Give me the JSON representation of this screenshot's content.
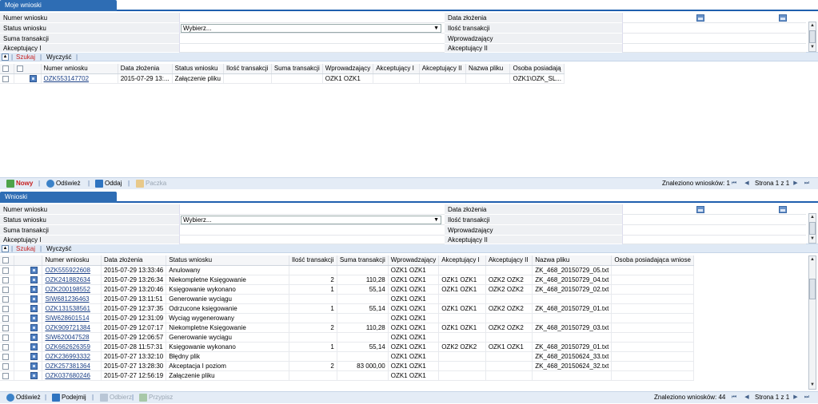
{
  "top": {
    "tab": "Moje wnioski",
    "filters": {
      "numer": "Numer wniosku",
      "status": "Status wniosku",
      "suma": "Suma transakcji",
      "akc1": "Akceptujący I",
      "data": "Data złożenia",
      "ilosc": "Ilość transakcji",
      "wprow": "Wprowadzający",
      "akc2": "Akceptujący II",
      "status_placeholder": "Wybierz..."
    },
    "actions": {
      "szukaj": "Szukaj",
      "wyczysc": "Wyczyść"
    },
    "columns": [
      "Numer wniosku",
      "Data złożenia",
      "Status wniosku",
      "Ilość transakcji",
      "Suma transakcji",
      "Wprowadzający",
      "Akceptujący I",
      "Akceptujący II",
      "Nazwa pliku",
      "Osoba posiadają"
    ],
    "rows": [
      {
        "nr": "OZK553147702",
        "data": "2015-07-29 13:...",
        "status": "Załączenie pliku",
        "ilosc": "",
        "suma": "",
        "wprow": "OZK1 OZK1",
        "akc1": "",
        "akc2": "",
        "plik": "",
        "osoba": "OZK1\\OZK_SL..."
      }
    ],
    "toolbar": {
      "nowy": "Nowy",
      "odswiez": "Odśwież",
      "oddaj": "Oddaj",
      "paczka": "Paczka"
    },
    "pager": {
      "found": "Znaleziono wniosków: 1",
      "page": "Strona 1 z 1"
    }
  },
  "bottom": {
    "tab": "Wnioski",
    "filters": {
      "numer": "Numer wniosku",
      "status": "Status wniosku",
      "suma": "Suma transakcji",
      "akc1": "Akceptujący I",
      "data": "Data złożenia",
      "ilosc": "Ilość transakcji",
      "wprow": "Wprowadzający",
      "akc2": "Akceptujący II",
      "status_placeholder": "Wybierz..."
    },
    "actions": {
      "szukaj": "Szukaj",
      "wyczysc": "Wyczyść"
    },
    "columns": [
      "Numer wniosku",
      "Data złożenia",
      "Status wniosku",
      "Ilość transakcji",
      "Suma transakcji",
      "Wprowadzający",
      "Akceptujący I",
      "Akceptujący II",
      "Nazwa pliku",
      "Osoba posiadająca wniose"
    ],
    "rows": [
      {
        "nr": "OZK555922608",
        "data": "2015-07-29 13:33:46",
        "status": "Anulowany",
        "ilosc": "",
        "suma": "",
        "wprow": "OZK1 OZK1",
        "akc1": "",
        "akc2": "",
        "plik": "ZK_468_20150729_05.txt",
        "osoba": ""
      },
      {
        "nr": "OZK241882634",
        "data": "2015-07-29 13:26:34",
        "status": "Niekompletne Księgowanie",
        "ilosc": "2",
        "suma": "110,28",
        "wprow": "OZK1 OZK1",
        "akc1": "OZK1 OZK1",
        "akc2": "OZK2 OZK2",
        "plik": "ZK_468_20150729_04.txt",
        "osoba": ""
      },
      {
        "nr": "OZK200198552",
        "data": "2015-07-29 13:20:46",
        "status": "Księgowanie wykonano",
        "ilosc": "1",
        "suma": "55,14",
        "wprow": "OZK1 OZK1",
        "akc1": "OZK1 OZK1",
        "akc2": "OZK2 OZK2",
        "plik": "ZK_468_20150729_02.txt",
        "osoba": ""
      },
      {
        "nr": "SIW681236463",
        "data": "2015-07-29 13:11:51",
        "status": "Generowanie wyciągu",
        "ilosc": "",
        "suma": "",
        "wprow": "OZK1 OZK1",
        "akc1": "",
        "akc2": "",
        "plik": "",
        "osoba": ""
      },
      {
        "nr": "OZK131538561",
        "data": "2015-07-29 12:37:35",
        "status": "Odrzucone księgowanie",
        "ilosc": "1",
        "suma": "55,14",
        "wprow": "OZK1 OZK1",
        "akc1": "OZK1 OZK1",
        "akc2": "OZK2 OZK2",
        "plik": "ZK_468_20150729_01.txt",
        "osoba": ""
      },
      {
        "nr": "SIW628601514",
        "data": "2015-07-29 12:31:09",
        "status": "Wyciąg wygenerowany",
        "ilosc": "",
        "suma": "",
        "wprow": "OZK1 OZK1",
        "akc1": "",
        "akc2": "",
        "plik": "",
        "osoba": ""
      },
      {
        "nr": "OZK909721384",
        "data": "2015-07-29 12:07:17",
        "status": "Niekompletne Księgowanie",
        "ilosc": "2",
        "suma": "110,28",
        "wprow": "OZK1 OZK1",
        "akc1": "OZK1 OZK1",
        "akc2": "OZK2 OZK2",
        "plik": "ZK_468_20150729_03.txt",
        "osoba": ""
      },
      {
        "nr": "SIW620047528",
        "data": "2015-07-29 12:06:57",
        "status": "Generowanie wyciągu",
        "ilosc": "",
        "suma": "",
        "wprow": "OZK1 OZK1",
        "akc1": "",
        "akc2": "",
        "plik": "",
        "osoba": ""
      },
      {
        "nr": "OZK662626359",
        "data": "2015-07-28 11:57:31",
        "status": "Księgowanie wykonano",
        "ilosc": "1",
        "suma": "55,14",
        "wprow": "OZK1 OZK1",
        "akc1": "OZK2 OZK2",
        "akc2": "OZK1 OZK1",
        "plik": "ZK_468_20150729_01.txt",
        "osoba": ""
      },
      {
        "nr": "OZK236993332",
        "data": "2015-07-27 13:32:10",
        "status": "Błędny plik",
        "ilosc": "",
        "suma": "",
        "wprow": "OZK1 OZK1",
        "akc1": "",
        "akc2": "",
        "plik": "ZK_468_20150624_33.txt",
        "osoba": ""
      },
      {
        "nr": "OZK257381364",
        "data": "2015-07-27 13:28:30",
        "status": "Akceptacja I poziom",
        "ilosc": "2",
        "suma": "83 000,00",
        "wprow": "OZK1 OZK1",
        "akc1": "",
        "akc2": "",
        "plik": "ZK_468_20150624_32.txt",
        "osoba": ""
      },
      {
        "nr": "OZK037680246",
        "data": "2015-07-27 12:56:19",
        "status": "Załączenie pliku",
        "ilosc": "",
        "suma": "",
        "wprow": "OZK1 OZK1",
        "akc1": "",
        "akc2": "",
        "plik": "",
        "osoba": ""
      }
    ],
    "toolbar": {
      "odswiez": "Odśwież",
      "podejmij": "Podejmij",
      "odbierz": "Odbierz",
      "przypisz": "Przypisz"
    },
    "pager": {
      "found": "Znaleziono wniosków: 44",
      "page": "Strona 1 z 1"
    }
  },
  "colors": {
    "accent": "#2e6db4",
    "link": "#1a3f86",
    "search": "#c62020"
  }
}
